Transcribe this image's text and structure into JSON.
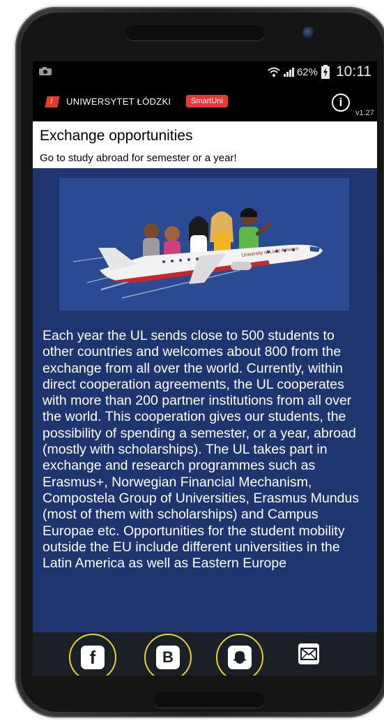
{
  "statusbar": {
    "battery": "62%",
    "time": "10:11"
  },
  "appbar": {
    "logo_letter": "i",
    "app_name": "UNIWERSYTET ŁÓDZKI",
    "badge": "SmartUni",
    "info_icon": "i",
    "version": "v1.27"
  },
  "header": {
    "title": "Exchange opportunities",
    "subtitle": "Go to study abroad for semester or a year!"
  },
  "illustration": {
    "plane_text": "University of Lodz Airways"
  },
  "article": {
    "text": "Each year the UL sends close to 500 students to other countries and welcomes about 800 from the exchange from all over the world. Currently, within direct cooperation agreements, the UL cooperates with more than 200 partner institutions from all over the world. This cooperation gives our students, the possibility of spending a semester, or a year, abroad (mostly with scholarships). The UL takes part in exchange and research programmes such as Erasmus+, Norwegian Financial Mechanism, Compostela Group of Universities, Erasmus Mundus (most of them with scholarships) and Campus Europae etc. Opportunities for the student mobility outside the EU include different universities in the Latin America as well as Eastern Europe"
  },
  "bottombar": {
    "facebook_glyph": "f",
    "b_glyph": "B",
    "icons": [
      "facebook-icon",
      "b-icon",
      "snapchat-icon",
      "mail-icon"
    ]
  },
  "colors": {
    "screen_bg": "#1e3570",
    "accent_red": "#e53935",
    "ring_yellow": "#e4d438"
  }
}
